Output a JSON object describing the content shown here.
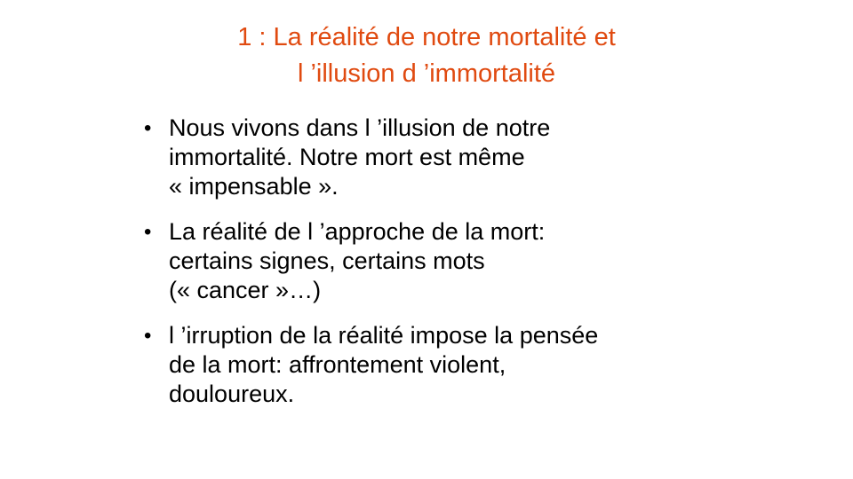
{
  "slide": {
    "title_lines": [
      "1 : La réalité de notre mortalité et",
      "l ’illusion d ’immortalité"
    ],
    "bullet_glyph": "•",
    "bullets": [
      {
        "lines": [
          "Nous vivons dans l ’illusion de notre",
          "immortalité. Notre mort est même",
          "« impensable »."
        ]
      },
      {
        "lines": [
          "La réalité de l ’approche de la mort:",
          "certains signes, certains mots",
          "(« cancer »…)"
        ]
      },
      {
        "lines": [
          "l ’irruption de la réalité impose la pensée",
          "de la mort: affrontement violent,",
          "douloureux."
        ]
      }
    ],
    "colors": {
      "title": "#e04a10",
      "text": "#000000",
      "background": "#ffffff"
    }
  }
}
